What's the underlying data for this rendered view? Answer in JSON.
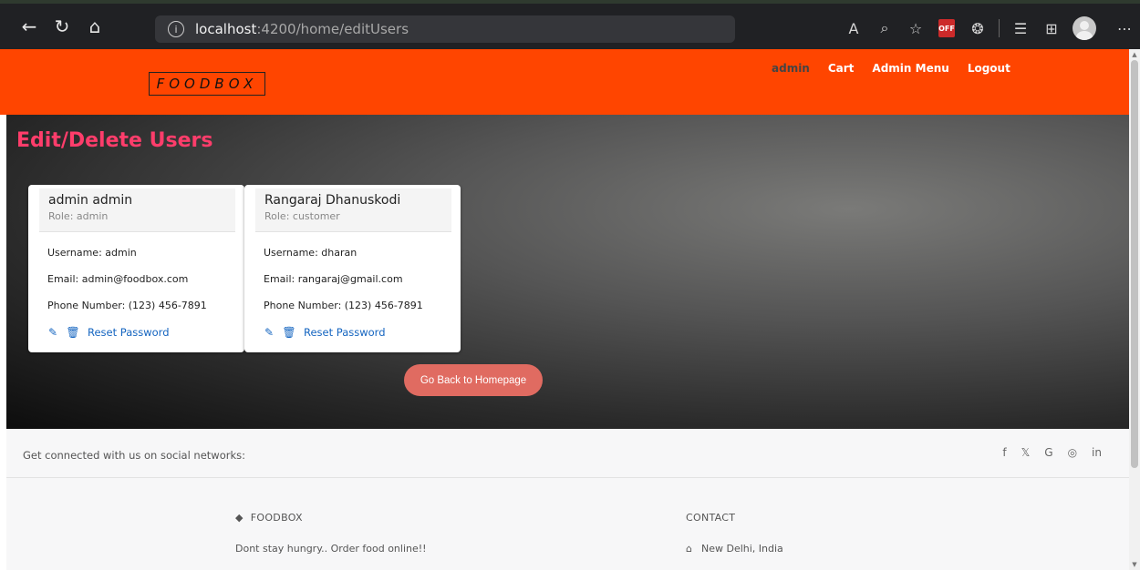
{
  "browser": {
    "url_host": "localhost",
    "url_path": ":4200/home/editUsers",
    "icons": [
      "back-icon",
      "refresh-icon",
      "home-icon",
      "info-icon",
      "read-aloud-icon",
      "zoom-icon",
      "favorite-icon",
      "extension-off-icon",
      "extensions-icon",
      "favorites-icon",
      "collections-icon",
      "profile-icon",
      "more-icon"
    ],
    "off_badge": "OFF"
  },
  "header": {
    "logo": "FOODBOX",
    "nav": [
      {
        "label": "admin"
      },
      {
        "label": "Cart"
      },
      {
        "label": "Admin Menu"
      },
      {
        "label": "Logout"
      }
    ]
  },
  "main": {
    "title": "Edit/Delete Users",
    "users": [
      {
        "name": "admin admin",
        "role": "Role: admin",
        "username": "Username: admin",
        "email": "Email: admin@foodbox.com",
        "phone": "Phone Number: (123) 456-7891",
        "reset_label": "Reset Password"
      },
      {
        "name": "Rangaraj Dhanuskodi",
        "role": "Role: customer",
        "username": "Username: dharan",
        "email": "Email: rangaraj@gmail.com",
        "phone": "Phone Number: (123) 456-7891",
        "reset_label": "Reset Password"
      }
    ],
    "back_button": "Go Back to Homepage"
  },
  "footer": {
    "social_text": "Get connected with us on social networks:",
    "social_icons": [
      "f",
      "𝕏",
      "G",
      "◎",
      "in"
    ],
    "brand_title": "FOODBOX",
    "brand_text": "Dont stay hungry.. Order food online!!",
    "contact_title": "CONTACT",
    "contact_address": "New Delhi, India"
  },
  "colors": {
    "header_bg": "#ff4500",
    "title": "#ff3d6b",
    "link": "#1565c0",
    "button": "#e06b61"
  }
}
